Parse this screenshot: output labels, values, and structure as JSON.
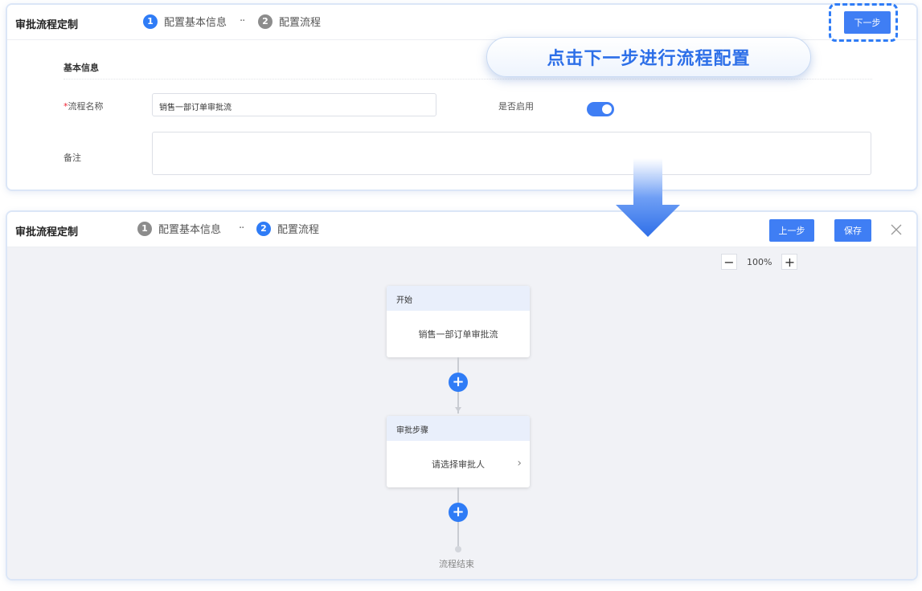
{
  "top_panel": {
    "title": "审批流程定制",
    "steps": [
      {
        "num": "1",
        "label": "配置基本信息"
      },
      {
        "num": "2",
        "label": "配置流程"
      }
    ],
    "dots": "··",
    "next_button": "下一步",
    "section_title": "基本信息",
    "fields": {
      "name_required_mark": "*",
      "name_label": "流程名称",
      "name_value": "销售一部订单审批流",
      "enabled_label": "是否启用",
      "enabled": true,
      "remark_label": "备注",
      "remark_value": ""
    }
  },
  "callout": "点击下一步进行流程配置",
  "bottom_panel": {
    "title": "审批流程定制",
    "steps": [
      {
        "num": "1",
        "label": "配置基本信息"
      },
      {
        "num": "2",
        "label": "配置流程"
      }
    ],
    "dots": "··",
    "prev_button": "上一步",
    "save_button": "保存",
    "close_icon": "close-icon",
    "zoom": {
      "minus": "−",
      "value": "100%",
      "plus": "+"
    },
    "start_node": {
      "header": "开始",
      "body": "销售一部订单审批流"
    },
    "approval_node": {
      "header": "审批步骤",
      "body": "请选择审批人",
      "chevron": "›"
    },
    "add_icon": "+",
    "end_label": "流程结束"
  },
  "colors": {
    "accent": "#2f7cf6",
    "canvas": "#f1f2f6",
    "node_header": "#e9effb"
  }
}
